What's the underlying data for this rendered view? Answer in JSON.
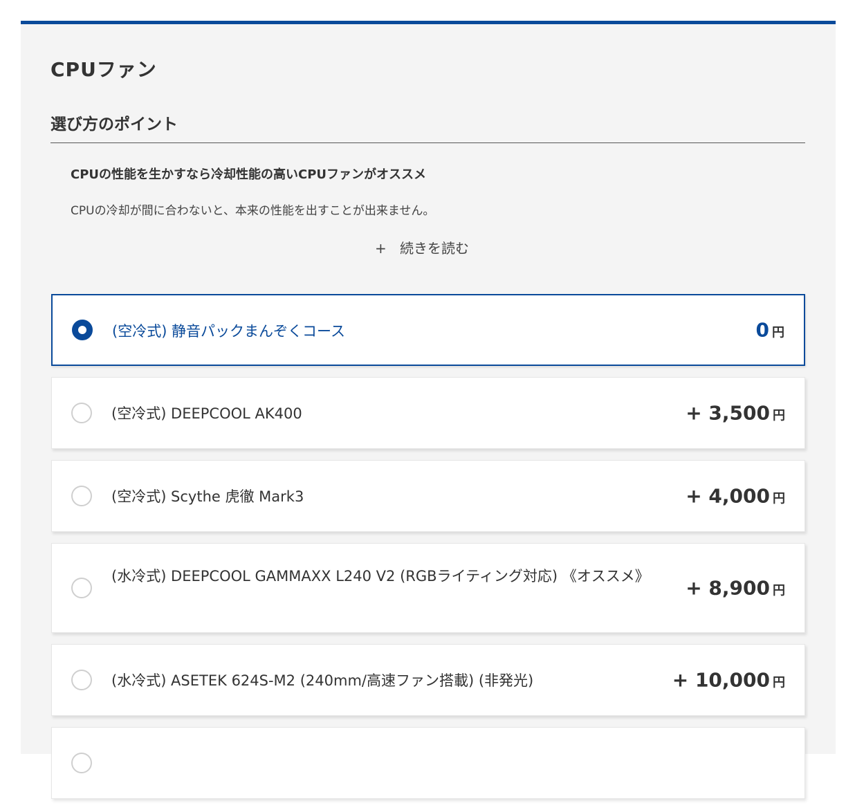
{
  "section": {
    "title": "CPUファン",
    "subheading": "選び方のポイント"
  },
  "point": {
    "heading": "CPUの性能を生かすなら冷却性能の高いCPUファンがオススメ",
    "body": "CPUの冷却が間に合わないと、本来の性能を出すことが出来ません。",
    "read_more_icon": "+",
    "read_more_label": "続きを読む"
  },
  "currency": "円",
  "colors": {
    "accent": "#0a4a9a",
    "panel_bg": "#f4f4f4"
  },
  "options": [
    {
      "label": "(空冷式) 静音パックまんぞくコース",
      "price": "0",
      "selected": true
    },
    {
      "label": "(空冷式) DEEPCOOL AK400",
      "price": "+ 3,500",
      "selected": false
    },
    {
      "label": "(空冷式) Scythe 虎徹 Mark3",
      "price": "+ 4,000",
      "selected": false
    },
    {
      "label": "(水冷式) DEEPCOOL GAMMAXX L240 V2 (RGBライティング対応) 《オススメ》",
      "price": "+ 8,900",
      "selected": false
    },
    {
      "label": "(水冷式) ASETEK 624S-M2 (240mm/高速ファン搭載) (非発光)",
      "price": "+ 10,000",
      "selected": false
    }
  ]
}
